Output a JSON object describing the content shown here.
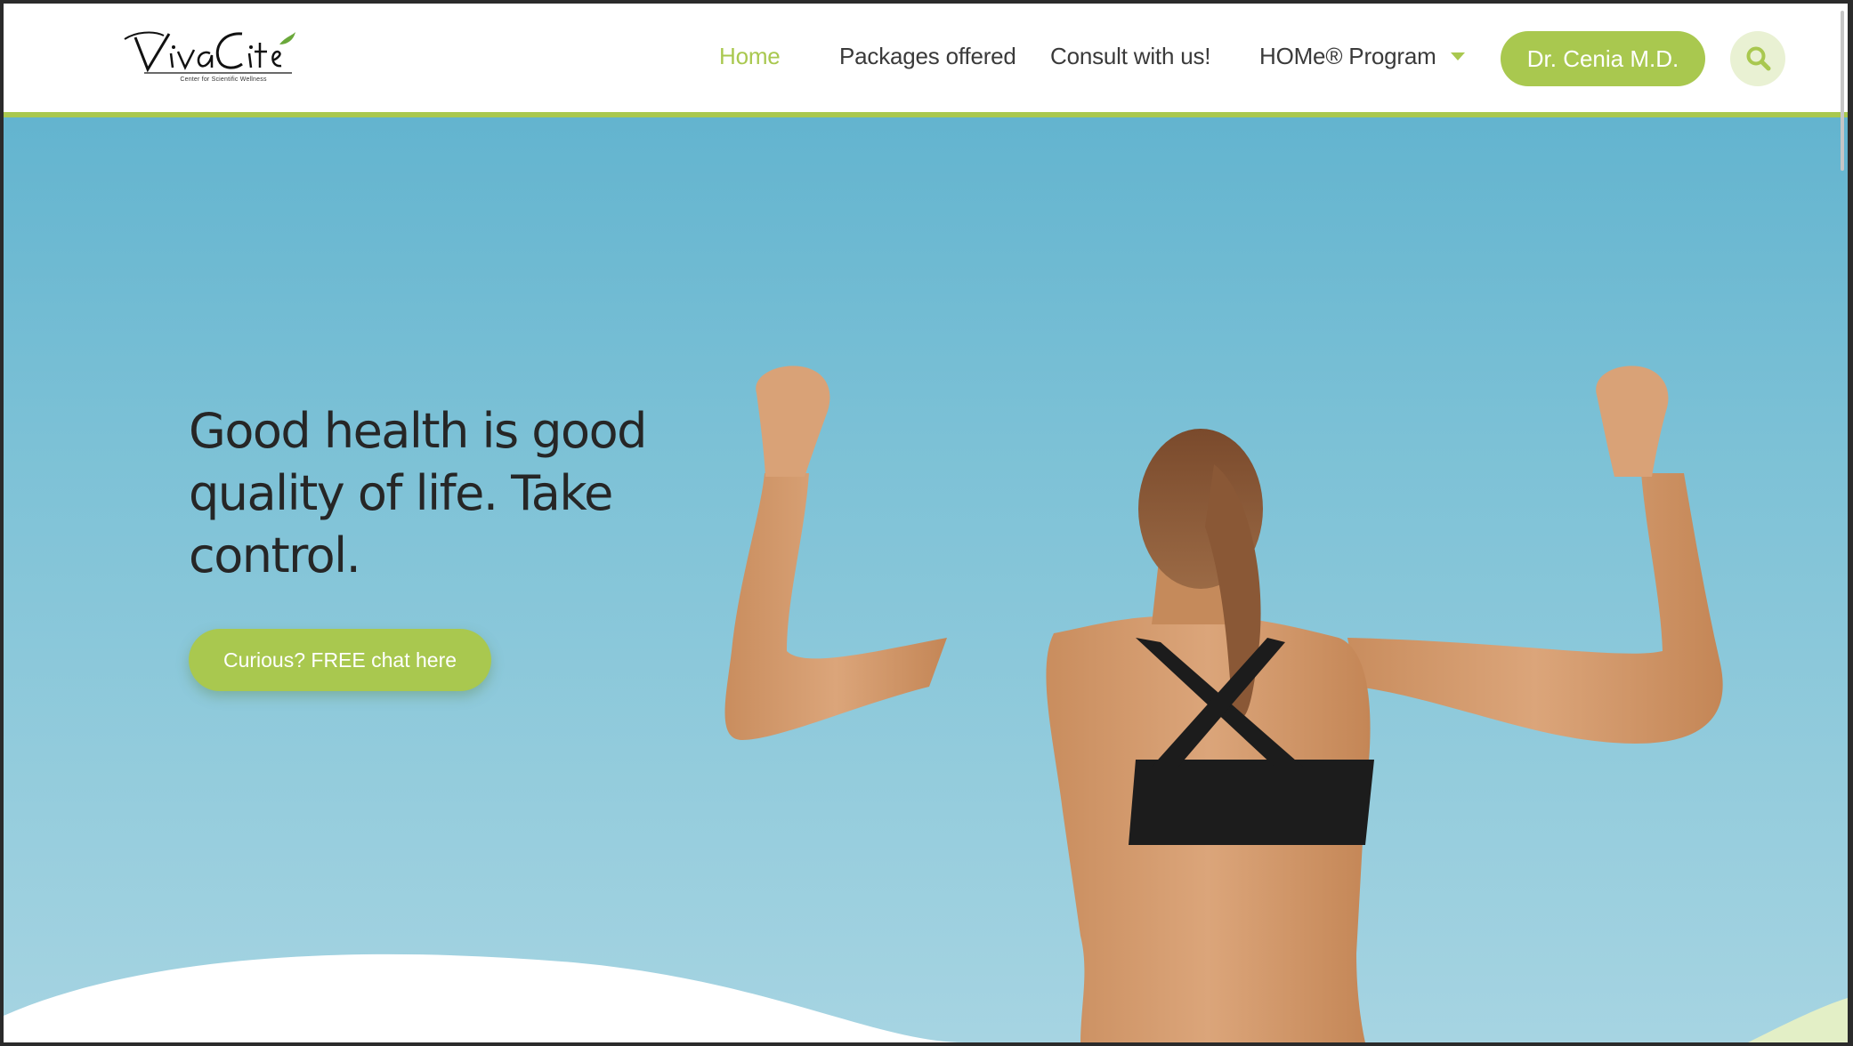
{
  "brand": {
    "name": "VivaCité",
    "tagline": "Center for Scientific Wellness"
  },
  "nav": {
    "items": [
      {
        "label": "Home",
        "active": true
      },
      {
        "label": "Packages offered",
        "active": false
      },
      {
        "label": "Consult with us!",
        "active": false
      },
      {
        "label": "HOMe® Program",
        "active": false,
        "has_dropdown": true
      }
    ],
    "doctor_button": "Dr. Cenia M.D.",
    "search_icon": "search-icon"
  },
  "hero": {
    "headline": "Good health is good quality of life. Take control.",
    "cta_label": "Curious? FREE chat here",
    "image": "woman flexing both arms, viewed from behind, against blue sky"
  },
  "colors": {
    "accent": "#a9c84f",
    "accent_light": "#e9f1d3",
    "text": "#3a3a3a",
    "sky": "#7cc1d6"
  }
}
